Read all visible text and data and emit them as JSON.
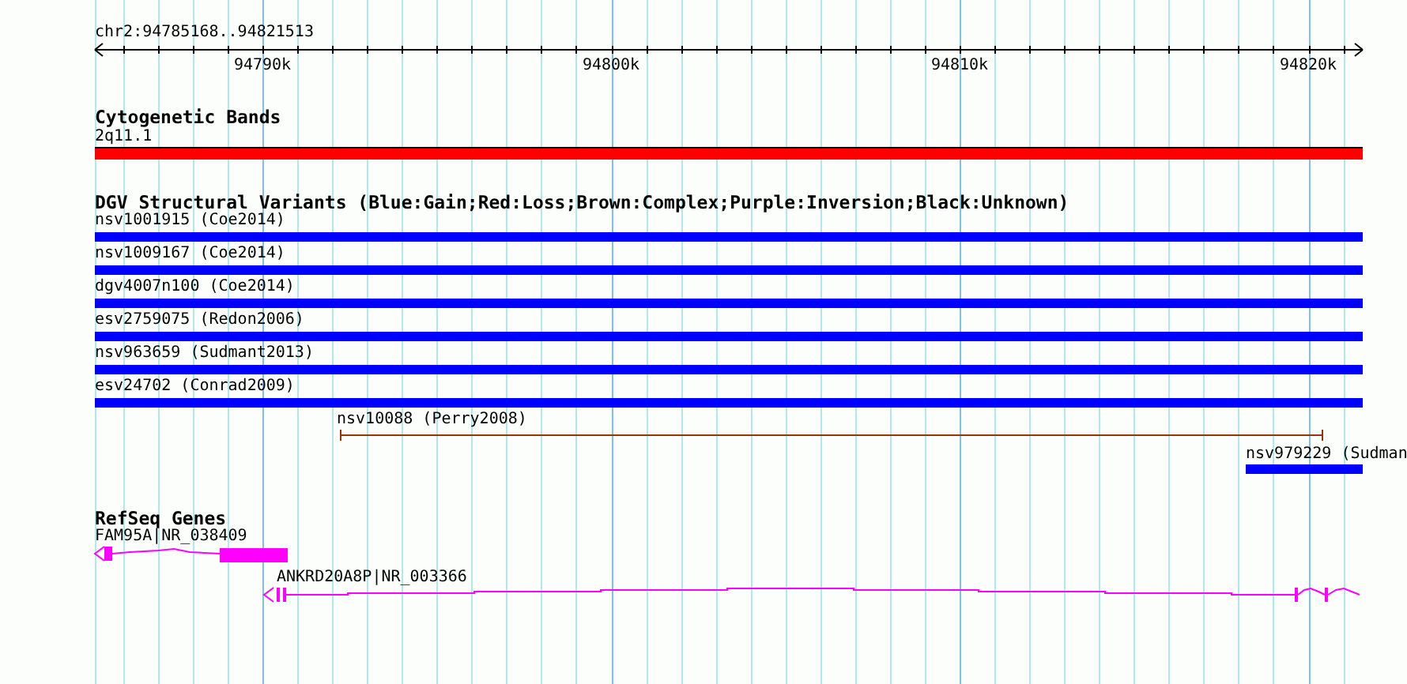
{
  "ruler": {
    "region": "chr2:94785168..94821513",
    "ticks": [
      "94790k",
      "94800k",
      "94810k",
      "94820k"
    ]
  },
  "tracks": [
    {
      "kind": "bands",
      "title": "Cytogenetic Bands",
      "features": [
        {
          "label": "2q11.1",
          "color": "#ff0000"
        }
      ]
    },
    {
      "kind": "variants",
      "title": "DGV Structural Variants (Blue:Gain;Red:Loss;Brown:Complex;Purple:Inversion;Black:Unknown)",
      "features": [
        {
          "label": "nsv1001915 (Coe2014)",
          "kind": "bar",
          "color": "#0000ff"
        },
        {
          "label": "nsv1009167 (Coe2014)",
          "kind": "bar",
          "color": "#0000ff"
        },
        {
          "label": "dgv4007n100 (Coe2014)",
          "kind": "bar",
          "color": "#0000ff"
        },
        {
          "label": "esv2759075 (Redon2006)",
          "kind": "bar",
          "color": "#0000ff"
        },
        {
          "label": "nsv963659 (Sudmant2013)",
          "kind": "bar",
          "color": "#0000ff"
        },
        {
          "label": "esv24702 (Conrad2009)",
          "kind": "bar",
          "color": "#0000ff"
        },
        {
          "label": "nsv10088 (Perry2008)",
          "kind": "span",
          "color": "#993300"
        },
        {
          "label": "nsv979229 (Sudman",
          "kind": "bar",
          "color": "#0000ff"
        }
      ]
    },
    {
      "kind": "genes",
      "title": "RefSeq Genes",
      "features": [
        {
          "label": "FAM95A|NR_038409",
          "color": "#ff00ff"
        },
        {
          "label": "ANKRD20A8P|NR_003366",
          "color": "#ff00ff"
        }
      ]
    }
  ]
}
